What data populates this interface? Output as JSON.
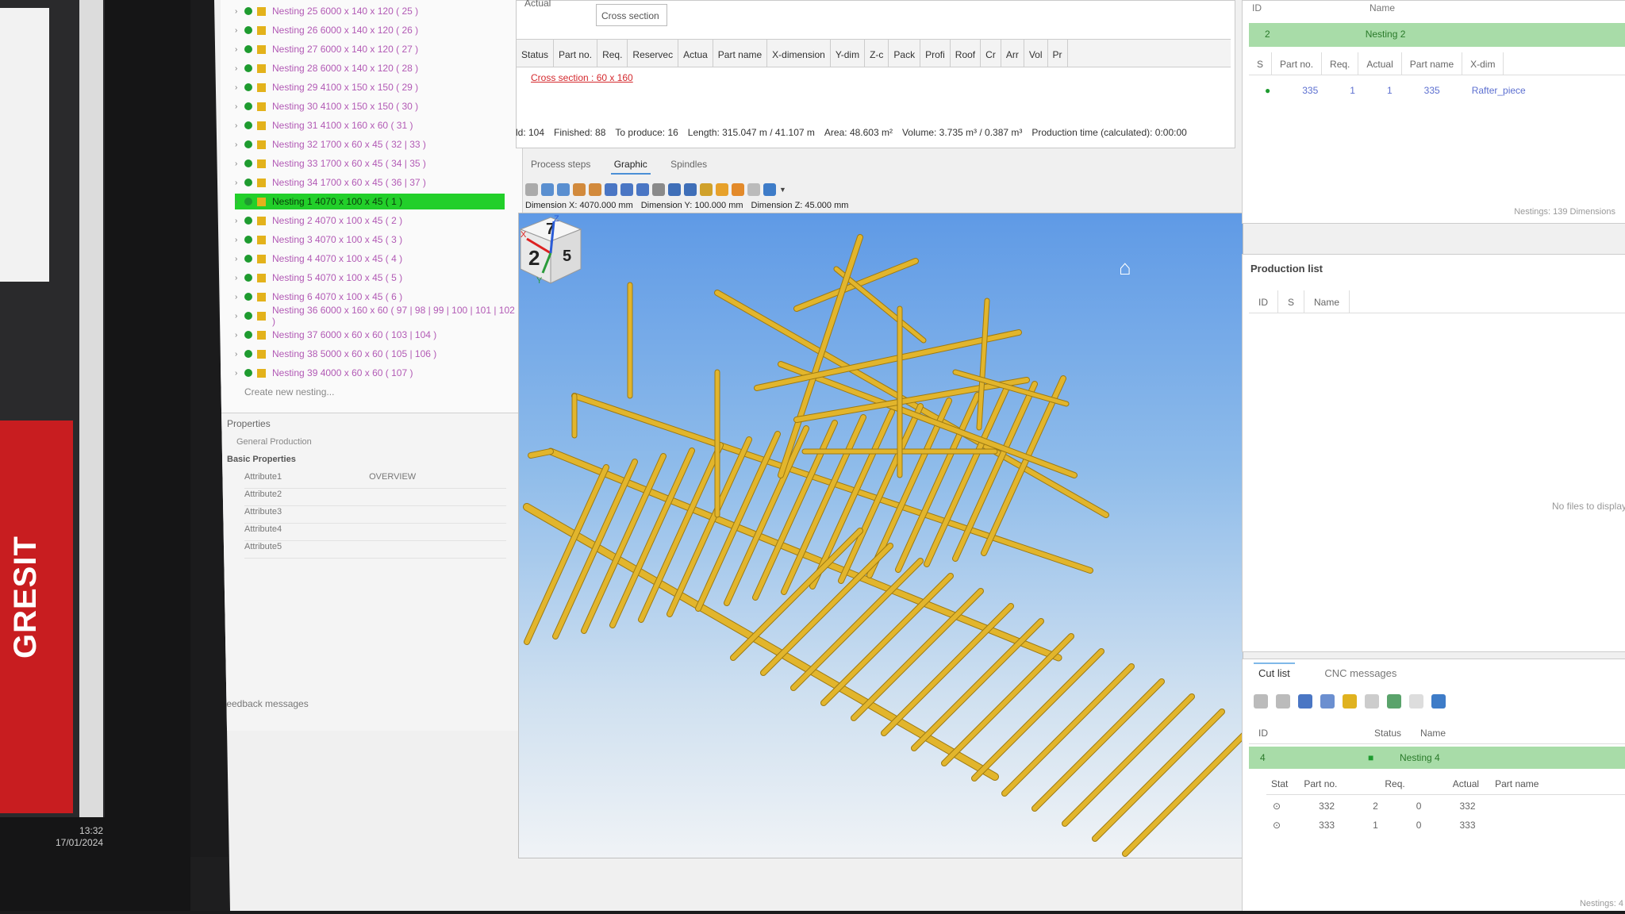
{
  "left_monitor": {
    "brand": "GRESIT",
    "clock_time": "13:32",
    "clock_date": "17/01/2024"
  },
  "tree": {
    "items": [
      {
        "label": "Nesting 25  6000 x 140 x 120  ( 25 )"
      },
      {
        "label": "Nesting 26  6000 x 140 x 120  ( 26 )"
      },
      {
        "label": "Nesting 27  6000 x 140 x 120  ( 27 )"
      },
      {
        "label": "Nesting 28  6000 x 140 x 120  ( 28 )"
      },
      {
        "label": "Nesting 29  4100 x 150 x 150  ( 29 )"
      },
      {
        "label": "Nesting 30  4100 x 150 x 150  ( 30 )"
      },
      {
        "label": "Nesting 31  4100 x 160 x 60  ( 31 )"
      },
      {
        "label": "Nesting 32  1700 x 60 x 45  ( 32 | 33 )"
      },
      {
        "label": "Nesting 33  1700 x 60 x 45  ( 34 | 35 )"
      },
      {
        "label": "Nesting 34  1700 x 60 x 45  ( 36 | 37 )"
      },
      {
        "label": "Nesting 1  4070 x 100 x 45  ( 1 )",
        "selected": true
      },
      {
        "label": "Nesting 2  4070 x 100 x 45  ( 2 )"
      },
      {
        "label": "Nesting 3  4070 x 100 x 45  ( 3 )"
      },
      {
        "label": "Nesting 4  4070 x 100 x 45  ( 4 )"
      },
      {
        "label": "Nesting 5  4070 x 100 x 45  ( 5 )"
      },
      {
        "label": "Nesting 6  4070 x 100 x 45  ( 6 )"
      },
      {
        "label": "Nesting 36  6000 x 160 x 60  ( 97 | 98 | 99 | 100 | 101 | 102 )"
      },
      {
        "label": "Nesting 37  6000 x 60 x 60  ( 103 | 104 )"
      },
      {
        "label": "Nesting 38  5000 x 60 x 60  ( 105 | 106 )"
      },
      {
        "label": "Nesting 39  4000 x 60 x 60  ( 107 )"
      }
    ],
    "add_label": "Create new nesting..."
  },
  "properties": {
    "title": "Properties",
    "tabs": "General   Production",
    "group": "Basic Properties",
    "rows": [
      "Attribute1",
      "Attribute2",
      "Attribute3",
      "Attribute4",
      "Attribute5"
    ],
    "value": "OVERVIEW",
    "log": "Feedback messages"
  },
  "top_table": {
    "dropdown": "Actual",
    "cross_section_label": "Cross section",
    "columns": [
      "Status",
      "Part no.",
      "Req.",
      "Reservec",
      "Actua",
      "Part name",
      "X-dimension",
      "Y-dim",
      "Z-c",
      "Pack",
      "Profi",
      "Roof",
      "Cr",
      "Arr",
      "Vol",
      "Pr"
    ],
    "group_row": "Cross section : 60 x 160",
    "stats": [
      "ld: 104",
      "Finished: 88",
      "To produce: 16",
      "Length: 315.047 m / 41.107 m",
      "Area: 48.603 m²",
      "Volume: 3.735 m³ / 0.387 m³",
      "Production time (calculated): 0:00:00"
    ]
  },
  "view": {
    "tabs": [
      "Process steps",
      "Graphic",
      "Spindles"
    ],
    "active_tab": "Graphic",
    "dimensions": [
      "Dimension X: 4070.000 mm",
      "Dimension Y: 100.000 mm",
      "Dimension Z: 45.000 mm"
    ],
    "cube_top": "7",
    "cube_front": "2",
    "cube_side": "5",
    "axes": [
      "X",
      "Y",
      "Z"
    ],
    "colors": {
      "beam": "#e2b52c",
      "beam_edge": "#9d7a12",
      "sky_top": "#5f9ae6",
      "sky_bottom": "#f0f3f6"
    }
  },
  "right_top": {
    "header_col": "ID",
    "header_name": "Name",
    "group": "Nesting 2",
    "group_id": "2",
    "columns": [
      "S",
      "Part no.",
      "Req.",
      "Actual",
      "Part name",
      "X-dim"
    ],
    "row": [
      "335",
      "1",
      "1",
      "335",
      "Rafter_piece"
    ],
    "footer": "Nestings: 139   Dimensions"
  },
  "production_list": {
    "title": "Production list",
    "columns": [
      "ID",
      "S",
      "Name"
    ],
    "empty": "No files to display"
  },
  "cut_list": {
    "tabs": [
      "Cut list",
      "CNC messages"
    ],
    "active_tab": "Cut list",
    "columns": [
      "ID",
      "Status",
      "Name"
    ],
    "group_id": "4",
    "group_name": "Nesting 4",
    "sub_columns": [
      "Stat",
      "Part no.",
      "Req.",
      "Actual",
      "Part name"
    ],
    "rows": [
      {
        "part": "332",
        "req": "2",
        "actual": "0",
        "name": "332"
      },
      {
        "part": "333",
        "req": "1",
        "actual": "0",
        "name": "333"
      }
    ],
    "footer": "Nestings: 4"
  }
}
